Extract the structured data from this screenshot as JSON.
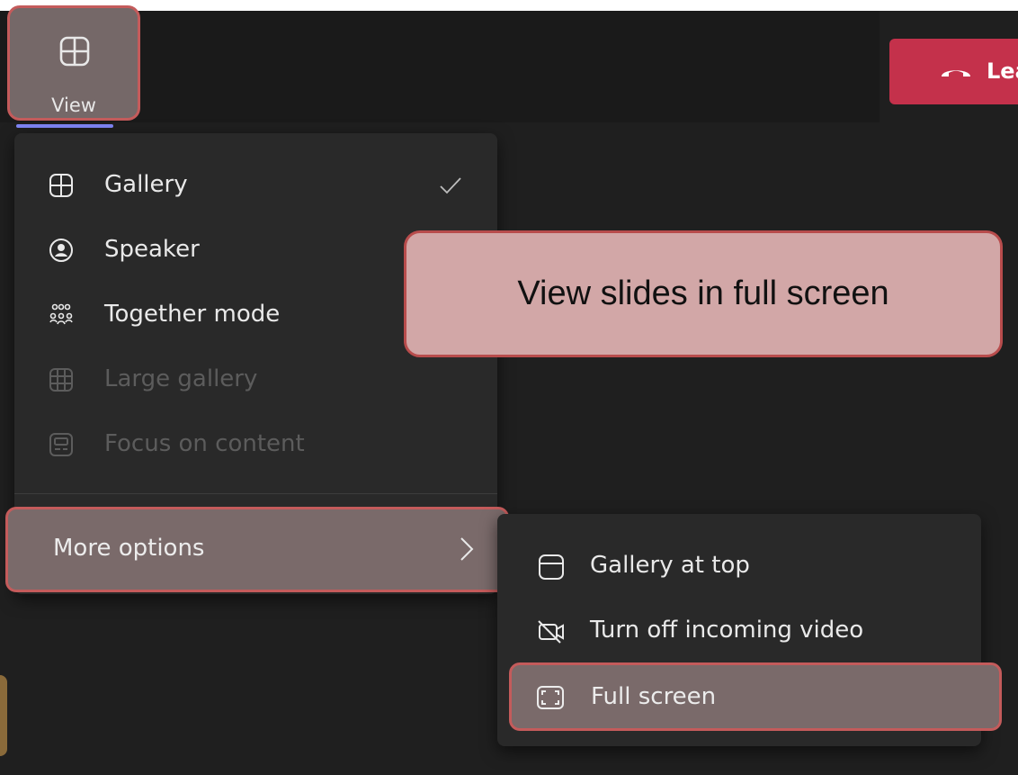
{
  "toolbar": {
    "view_label": "View",
    "leave_label": "Lea"
  },
  "view_menu": {
    "items": [
      {
        "label": "Gallery",
        "icon": "grid-icon",
        "checked": true,
        "disabled": false
      },
      {
        "label": "Speaker",
        "icon": "person-circle-icon",
        "checked": false,
        "disabled": false
      },
      {
        "label": "Together mode",
        "icon": "people-group-icon",
        "checked": false,
        "disabled": false
      },
      {
        "label": "Large gallery",
        "icon": "large-grid-icon",
        "checked": false,
        "disabled": true
      },
      {
        "label": "Focus on content",
        "icon": "content-icon",
        "checked": false,
        "disabled": true
      }
    ],
    "more_options_label": "More options"
  },
  "submenu": {
    "items": [
      {
        "label": "Gallery at top",
        "icon": "gallery-top-icon"
      },
      {
        "label": "Turn off incoming video",
        "icon": "video-off-icon"
      },
      {
        "label": "Full screen",
        "icon": "full-screen-icon"
      }
    ]
  },
  "callout": {
    "text": "View slides in full screen"
  },
  "colors": {
    "highlight_border": "#c45b5b",
    "leave_red": "#c4314b",
    "accent_underline": "#7f85f5",
    "menu_bg": "#292929"
  }
}
